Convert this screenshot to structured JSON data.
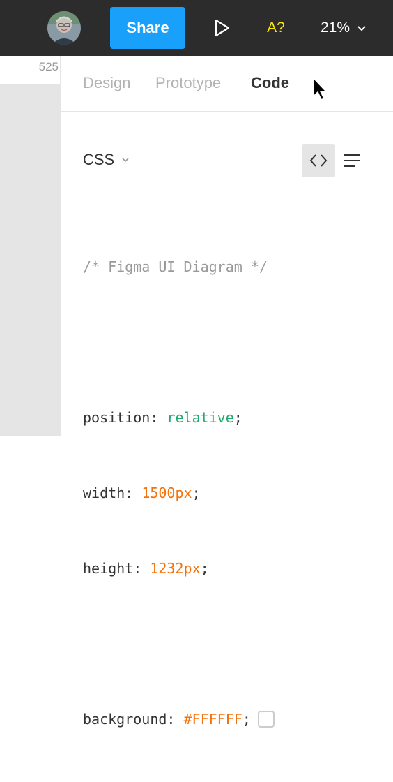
{
  "toolbar": {
    "share_label": "Share",
    "a11y_label": "A?",
    "zoom_label": "21%",
    "icons": {
      "play": "play-icon",
      "zoom_chevron": "chevron-down-icon"
    }
  },
  "canvas": {
    "ruler_value": "525"
  },
  "panel": {
    "tabs": [
      {
        "label": "Design"
      },
      {
        "label": "Prototype"
      },
      {
        "label": "Code"
      }
    ],
    "active_tab": "Code",
    "language_label": "CSS",
    "icons": {
      "code_view": "code-brackets-icon",
      "list_view": "list-icon"
    },
    "code": {
      "comment": "/* Figma UI Diagram */",
      "position_prop": "position",
      "position_value": "relative",
      "width_prop": "width",
      "width_value": "1500px",
      "height_prop": "height",
      "height_value": "1232px",
      "background_prop": "background",
      "background_value": "#FFFFFF"
    }
  },
  "colors": {
    "toolbar_bg": "#2c2c2c",
    "accent_blue": "#18a0fb",
    "a11y_yellow": "#ffeb00",
    "keyword_green": "#1bab6b",
    "number_orange": "#f5710b",
    "comment_gray": "#999999"
  }
}
